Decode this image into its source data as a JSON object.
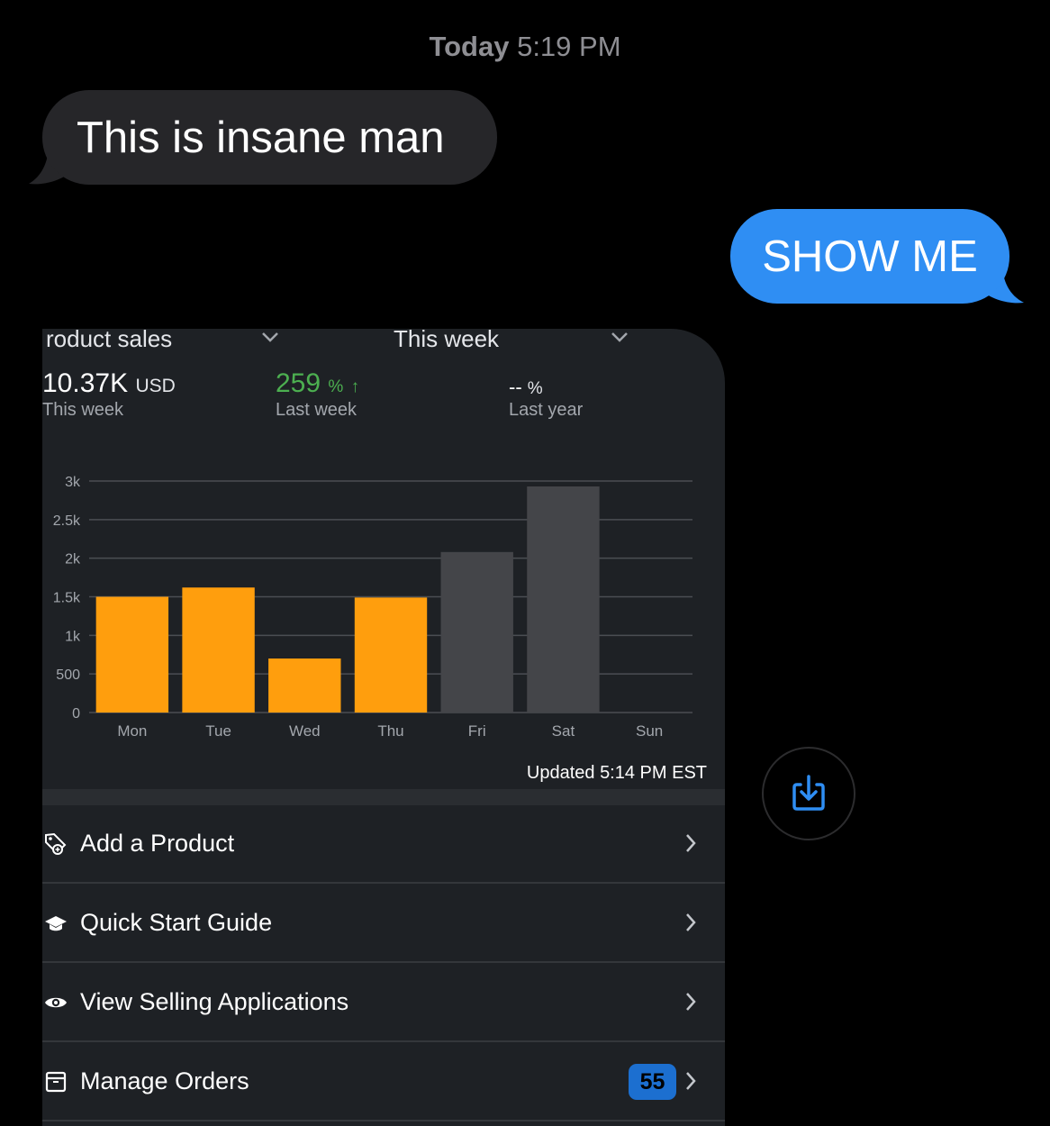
{
  "header": {
    "day": "Today",
    "time": "5:19 PM"
  },
  "messages": {
    "incoming": "This is insane man",
    "outgoing": "SHOW ME"
  },
  "dashboard": {
    "metric_selector": "roduct sales",
    "period_selector": "This week",
    "stats": [
      {
        "value": "10.37K",
        "unit": "USD",
        "label": "This week"
      },
      {
        "value": "259",
        "unit": "%",
        "arrow": "↑",
        "label": "Last week"
      },
      {
        "value": "--",
        "unit": "%",
        "label": "Last year"
      }
    ],
    "updated": "Updated 5:14 PM EST",
    "colors": {
      "current": "#ff9e0d",
      "previous": "#444549",
      "positive": "#4caf50",
      "badge": "#1c6fd0"
    }
  },
  "chart_data": {
    "type": "bar",
    "categories": [
      "Mon",
      "Tue",
      "Wed",
      "Thu",
      "Fri",
      "Sat",
      "Sun"
    ],
    "values": [
      1500,
      1620,
      700,
      1490,
      2080,
      2930,
      0
    ],
    "bar_colors": [
      "#ff9e0d",
      "#ff9e0d",
      "#ff9e0d",
      "#ff9e0d",
      "#444549",
      "#444549",
      "#444549"
    ],
    "ylim": [
      0,
      3000
    ],
    "yticks": [
      0,
      500,
      1000,
      1500,
      2000,
      2500,
      3000
    ],
    "ytick_labels": [
      "0",
      "500",
      "1k",
      "1.5k",
      "2k",
      "2.5k",
      "3k"
    ],
    "grid": true
  },
  "menu": [
    {
      "label": "Add a Product",
      "icon": "tag-icon"
    },
    {
      "label": "Quick Start Guide",
      "icon": "graduation-cap-icon"
    },
    {
      "label": "View Selling Applications",
      "icon": "eye-icon"
    },
    {
      "label": "Manage Orders",
      "icon": "box-icon",
      "badge": "55"
    }
  ]
}
